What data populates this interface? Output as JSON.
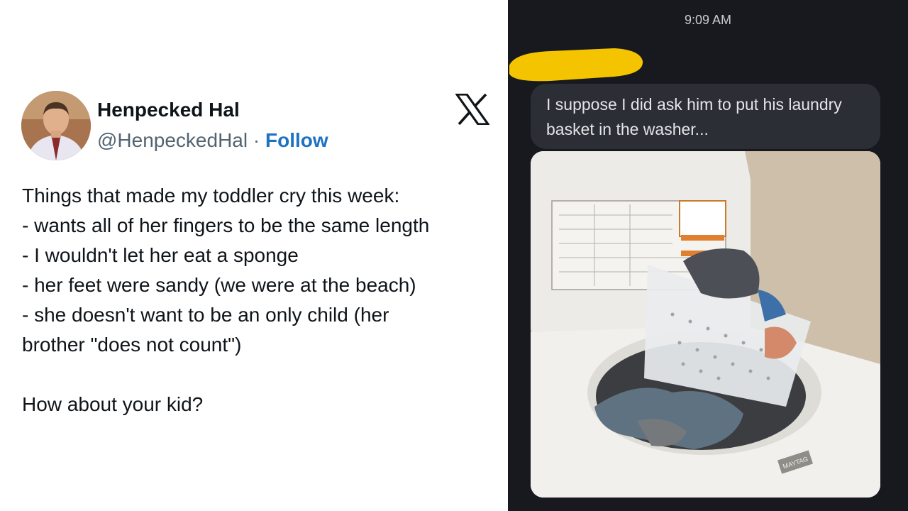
{
  "tweet": {
    "author_name": "Henpecked Hal",
    "handle": "@HenpeckedHal",
    "separator": "·",
    "follow_label": "Follow",
    "platform_icon": "x-logo-icon",
    "lines": [
      "Things that made my toddler cry this week:",
      "- wants all of her fingers to be the same length",
      "- I wouldn't let her eat a sponge",
      "- her feet were sandy (we were at the beach)",
      "- she doesn't want to be an only child (her",
      "brother \"does not count\")"
    ],
    "closing_line": "How about your kid?"
  },
  "chat": {
    "time": "9:09 AM",
    "message_text": "I suppose I did ask him to put his laundry basket in the washer...",
    "photo_brand_label": "MAYTAG",
    "colors": {
      "background": "#17191f",
      "bubble": "#2b2e35",
      "redaction": "#f5c400"
    }
  }
}
